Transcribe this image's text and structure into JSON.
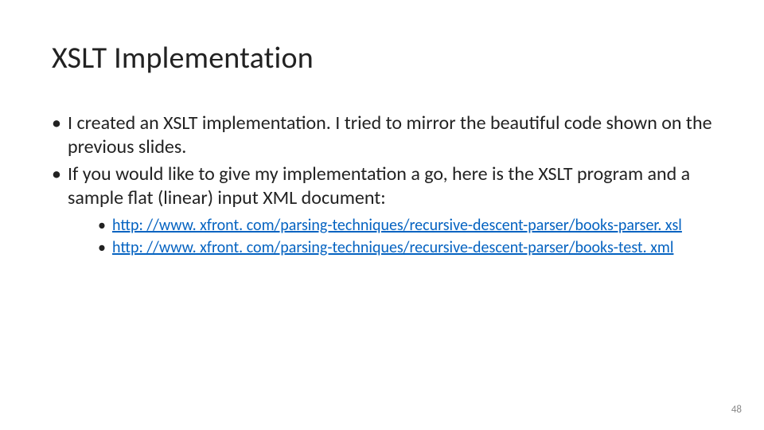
{
  "title": "XSLT Implementation",
  "bullets": [
    {
      "text": "I created an XSLT implementation. I tried to mirror the beautiful code shown on the previous slides."
    },
    {
      "text": "If you would like to give my implementation a go, here is the XSLT program and a sample flat (linear) input XML document:"
    }
  ],
  "links": [
    {
      "text": "http: //www. xfront. com/parsing-techniques/recursive-descent-parser/books-parser. xsl",
      "href": "http://www.xfront.com/parsing-techniques/recursive-descent-parser/books-parser.xsl"
    },
    {
      "text": "http: //www. xfront. com/parsing-techniques/recursive-descent-parser/books-test. xml",
      "href": "http://www.xfront.com/parsing-techniques/recursive-descent-parser/books-test.xml"
    }
  ],
  "page_number": "48"
}
